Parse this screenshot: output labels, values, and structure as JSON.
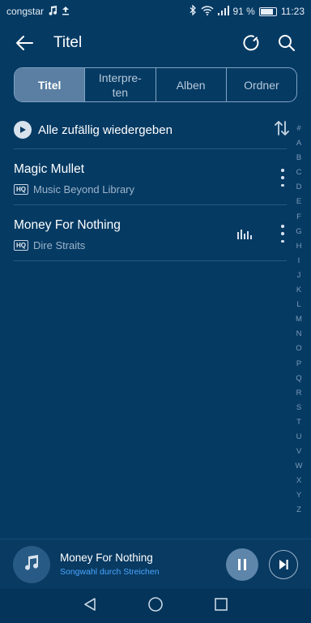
{
  "status_bar": {
    "carrier": "congstar",
    "battery": "91 %",
    "time": "11:23",
    "icons": [
      "music-note-icon",
      "upload-icon",
      "bluetooth-icon",
      "wifi-icon",
      "signal-icon",
      "battery-icon"
    ]
  },
  "header": {
    "title": "Titel",
    "back_icon": "arrow-left-icon",
    "actions": [
      "refresh-icon",
      "search-icon"
    ]
  },
  "tabs": [
    {
      "label": "Titel",
      "active": true
    },
    {
      "label": "Interpre-\nten",
      "active": false
    },
    {
      "label": "Alben",
      "active": false
    },
    {
      "label": "Ordner",
      "active": false
    }
  ],
  "shuffle": {
    "label": "Alle zufällig wiedergeben",
    "sort_icon": "sort-icon"
  },
  "songs": [
    {
      "title": "Magic Mullet",
      "badge": "HQ",
      "artist": "Music Beyond Library",
      "playing": false
    },
    {
      "title": "Money For Nothing",
      "badge": "HQ",
      "artist": "Dire Straits",
      "playing": true
    }
  ],
  "index_letters": [
    "#",
    "A",
    "B",
    "C",
    "D",
    "E",
    "F",
    "G",
    "H",
    "I",
    "J",
    "K",
    "L",
    "M",
    "N",
    "O",
    "P",
    "Q",
    "R",
    "S",
    "T",
    "U",
    "V",
    "W",
    "X",
    "Y",
    "Z"
  ],
  "player": {
    "title": "Money For Nothing",
    "hint": "Songwahl durch Streichen",
    "state": "playing"
  },
  "colors": {
    "background": "#053a63",
    "accent": "#49a6ff",
    "tab_active": "#5a7fa3"
  }
}
